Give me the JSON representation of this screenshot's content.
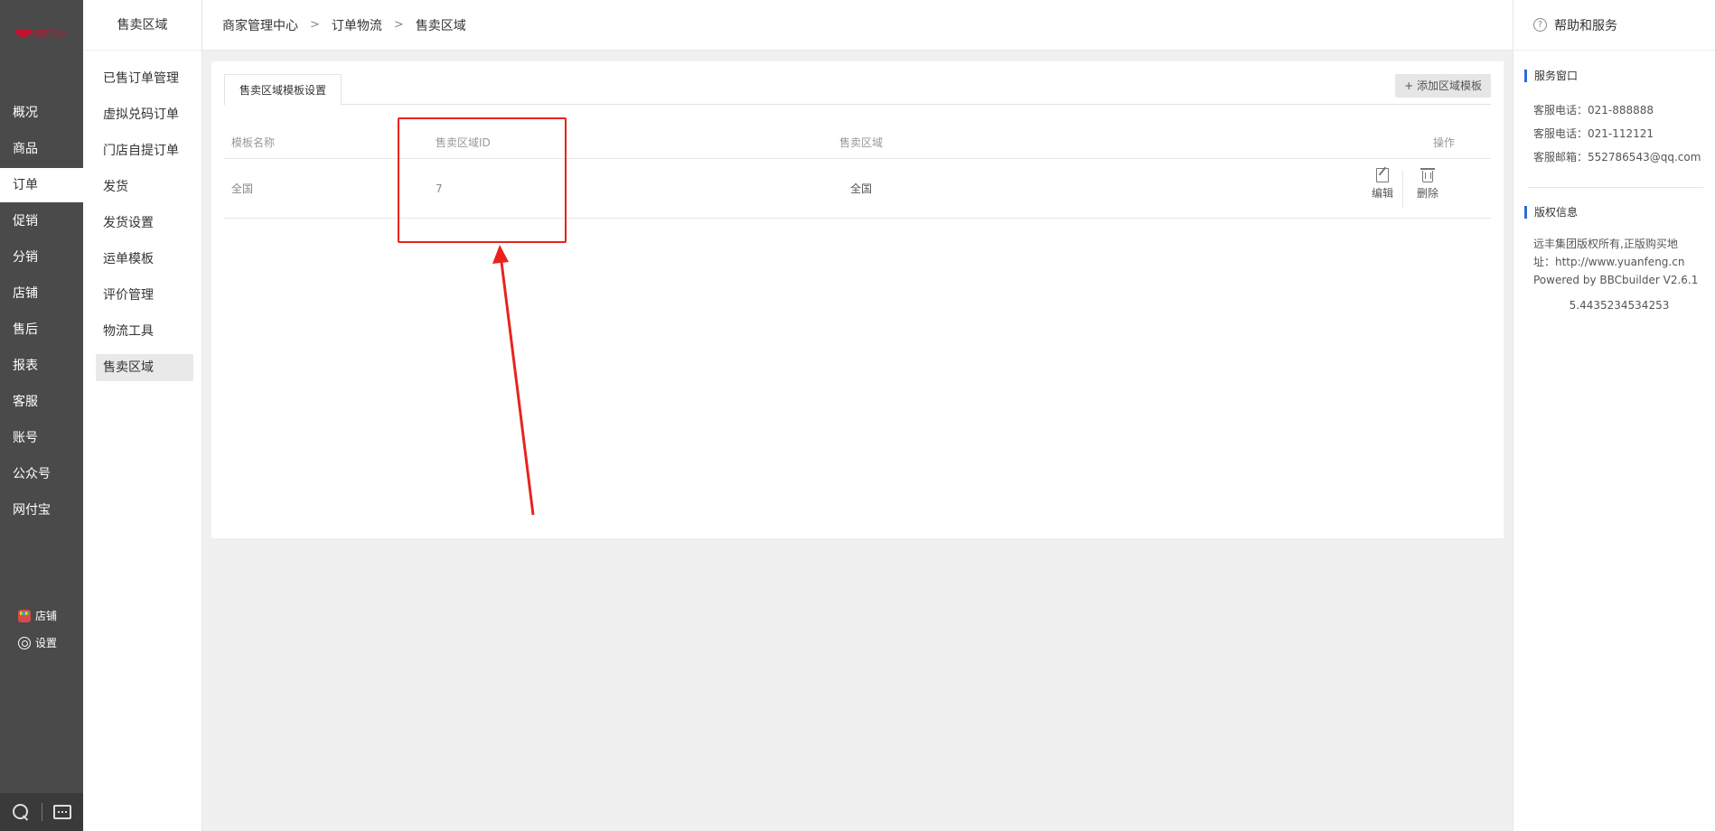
{
  "logo": {
    "text": "商家中心"
  },
  "main_nav": {
    "items": [
      {
        "label": "概况",
        "active": false
      },
      {
        "label": "商品",
        "active": false
      },
      {
        "label": "订单",
        "active": true
      },
      {
        "label": "促销",
        "active": false
      },
      {
        "label": "分销",
        "active": false
      },
      {
        "label": "店铺",
        "active": false
      },
      {
        "label": "售后",
        "active": false
      },
      {
        "label": "报表",
        "active": false
      },
      {
        "label": "客服",
        "active": false
      },
      {
        "label": "账号",
        "active": false
      },
      {
        "label": "公众号",
        "active": false
      },
      {
        "label": "网付宝",
        "active": false
      }
    ],
    "bottom_links": {
      "store_label": "店铺",
      "settings_label": "设置"
    }
  },
  "sub_nav": {
    "title": "售卖区域",
    "items": [
      {
        "label": "已售订单管理",
        "active": false
      },
      {
        "label": "虚拟兑码订单",
        "active": false
      },
      {
        "label": "门店自提订单",
        "active": false
      },
      {
        "label": "发货",
        "active": false
      },
      {
        "label": "发货设置",
        "active": false
      },
      {
        "label": "运单模板",
        "active": false
      },
      {
        "label": "评价管理",
        "active": false
      },
      {
        "label": "物流工具",
        "active": false
      },
      {
        "label": "售卖区域",
        "active": true
      }
    ]
  },
  "breadcrumb": [
    "商家管理中心",
    "订单物流",
    "售卖区域"
  ],
  "breadcrumb_separator": ">",
  "tabs": [
    {
      "label": "售卖区域模板设置",
      "active": true
    }
  ],
  "add_button": {
    "label": "+ 添加区域模板"
  },
  "table": {
    "headers": {
      "name": "模板名称",
      "id": "售卖区域ID",
      "area": "售卖区域",
      "actions": "操作"
    },
    "rows": [
      {
        "name": "全国",
        "id": "7",
        "area": "全国"
      }
    ],
    "actions": {
      "edit": "编辑",
      "delete": "删除"
    }
  },
  "help": {
    "title": "帮助和服务",
    "service_title": "服务窗口",
    "service_lines": [
      "客服电话：021-888888",
      "客服电话：021-112121",
      "客服邮箱：552786543@qq.com"
    ],
    "copyright_title": "版权信息",
    "copyright_lines": [
      "远丰集团版权所有,正版购买地址：http://www.yuanfeng.cn",
      "Powered by BBCbuilder V2.6.1"
    ],
    "version_number": "5.4435234534253"
  },
  "colors": {
    "sidebar_bg": "#4a4a4a",
    "accent_red": "#e8231b",
    "brand_red": "#c8102e",
    "section_marker_blue": "#2f6bd8"
  }
}
